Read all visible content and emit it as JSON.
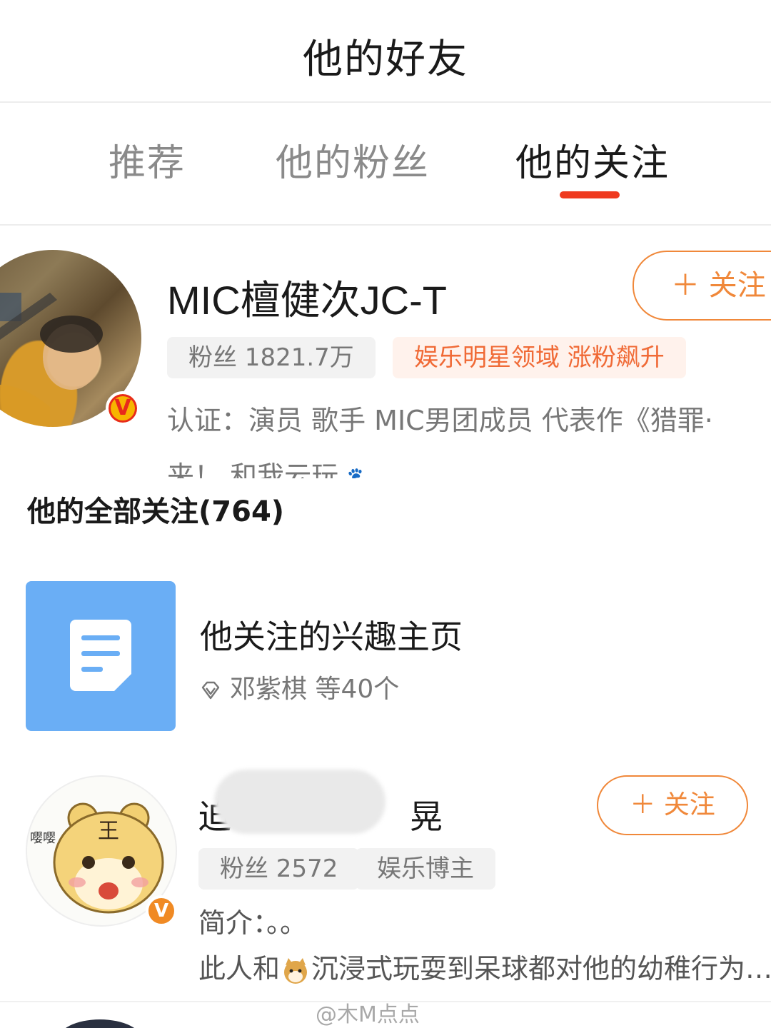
{
  "header": {
    "title": "他的好友"
  },
  "tabs": [
    {
      "label": "推荐",
      "active": false
    },
    {
      "label": "他的粉丝",
      "active": false
    },
    {
      "label": "他的关注",
      "active": true
    }
  ],
  "colors": {
    "accent": "#ef3a1f",
    "follow_orange": "#f0883a",
    "interest_blue": "#6aaef5",
    "hot_chip_text": "#f06a36"
  },
  "featured_user": {
    "name": "MIC檀健次JC-T",
    "follow_label": "＋ 关注",
    "fans_chip": "粉丝 1821.7万",
    "hot_chip": "娱乐明星领域 涨粉飙升",
    "verification": "认证：演员 歌手 MIC男团成员 代表作《猎罪·",
    "bio_line": "来！ 和我云玩",
    "badge": "V"
  },
  "section": {
    "title": "他的全部关注(764)"
  },
  "interest_pages": {
    "icon": "document-icon",
    "title": "他关注的兴趣主页",
    "subtitle": "邓紫棋 等40个"
  },
  "user_row": {
    "name_visible_start": "迫",
    "name_visible_end": "晃",
    "follow_label": "＋ 关注",
    "fans_chip": "粉丝 2572",
    "category_chip": "娱乐博主",
    "intro": "简介：。。",
    "bio_prefix": "此人和",
    "bio_suffix": "沉浸式玩耍到呆球都对他的幼稚行为…",
    "avatar_text": "王",
    "avatar_side_text": "嘤嘤",
    "badge": "V"
  },
  "watermark": "@木M点点"
}
